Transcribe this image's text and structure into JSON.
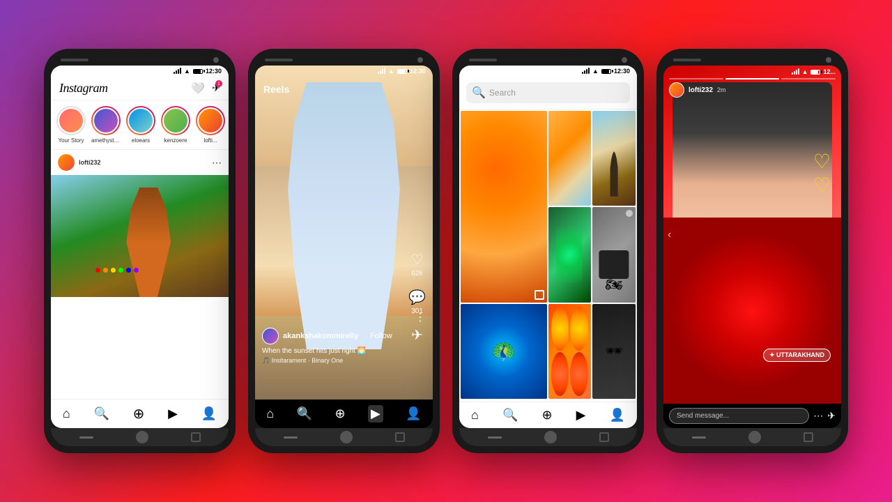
{
  "phones": [
    {
      "id": "phone1",
      "type": "feed",
      "statusBar": {
        "time": "12:30",
        "signal": true,
        "battery": true
      },
      "header": {
        "logo": "Instagram",
        "icons": [
          "heart",
          "send"
        ]
      },
      "stories": [
        {
          "label": "Your Story",
          "ring": false,
          "color": "av1"
        },
        {
          "label": "amethyst_grl",
          "ring": true,
          "color": "av2"
        },
        {
          "label": "eloears",
          "ring": true,
          "color": "av3"
        },
        {
          "label": "kenzoere",
          "ring": true,
          "color": "av4"
        },
        {
          "label": "lofti...",
          "ring": true,
          "color": "av5"
        }
      ],
      "post": {
        "username": "lofti232",
        "avatarColor": "av5"
      },
      "navItems": [
        "home",
        "search",
        "add",
        "reels",
        "profile"
      ]
    },
    {
      "id": "phone2",
      "type": "reels",
      "statusBar": {
        "time": "12:30",
        "signal": true,
        "battery": true
      },
      "reels": {
        "header": "Reels",
        "username": "akankshakommirelly",
        "followText": "· Follow",
        "caption": "When the sunset hits just right 🌅",
        "music": "🎵 Insitarament · Binary One",
        "likes": "62k",
        "comments": "301",
        "moreIcon": "⋮"
      },
      "navItems": [
        "home",
        "search",
        "add",
        "reels",
        "profile"
      ]
    },
    {
      "id": "phone3",
      "type": "explore",
      "statusBar": {
        "time": "12:30",
        "signal": true,
        "battery": true
      },
      "searchBar": {
        "placeholder": "Search",
        "icon": "search"
      },
      "navItems": [
        "home",
        "search",
        "add",
        "reels",
        "profile"
      ]
    },
    {
      "id": "phone4",
      "type": "story",
      "statusBar": {
        "time": "12...",
        "signal": true,
        "battery": true
      },
      "story": {
        "username": "lofti232",
        "time": "2m",
        "locationTag": "✦ UTTARAKHAND",
        "messagePlaceholder": "Send message..."
      },
      "navItems": [
        "chevron"
      ]
    }
  ],
  "icons": {
    "home": "⌂",
    "search": "🔍",
    "add": "➕",
    "reels": "▶",
    "profile": "👤",
    "heart": "🤍",
    "send": "📨",
    "chevron_left": "‹"
  }
}
